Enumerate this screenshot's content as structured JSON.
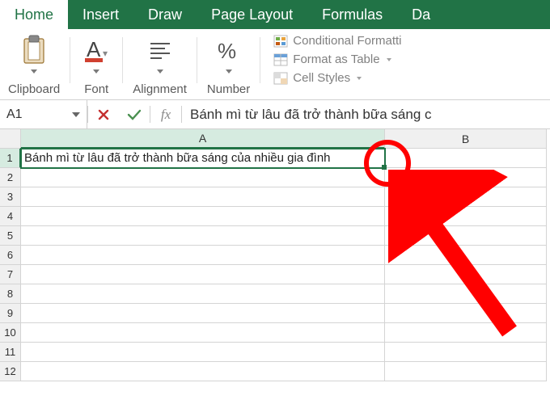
{
  "tabs": {
    "home": "Home",
    "insert": "Insert",
    "draw": "Draw",
    "page_layout": "Page Layout",
    "formulas": "Formulas",
    "data": "Da"
  },
  "ribbon": {
    "clipboard": "Clipboard",
    "font": "Font",
    "alignment": "Alignment",
    "number": "Number",
    "cond_format": "Conditional Formatti",
    "format_table": "Format as Table",
    "cell_styles": "Cell Styles"
  },
  "fx": {
    "name_box": "A1",
    "fx_label": "fx",
    "formula": "Bánh mì từ lâu đã trở thành bữa sáng c"
  },
  "cols": {
    "a": "A",
    "b": "B"
  },
  "rows": [
    "1",
    "2",
    "3",
    "4",
    "5",
    "6",
    "7",
    "8",
    "9",
    "10",
    "11",
    "12"
  ],
  "cell_a1": "Bánh mì từ lâu đã trở thành bữa sáng của nhiều gia đình"
}
